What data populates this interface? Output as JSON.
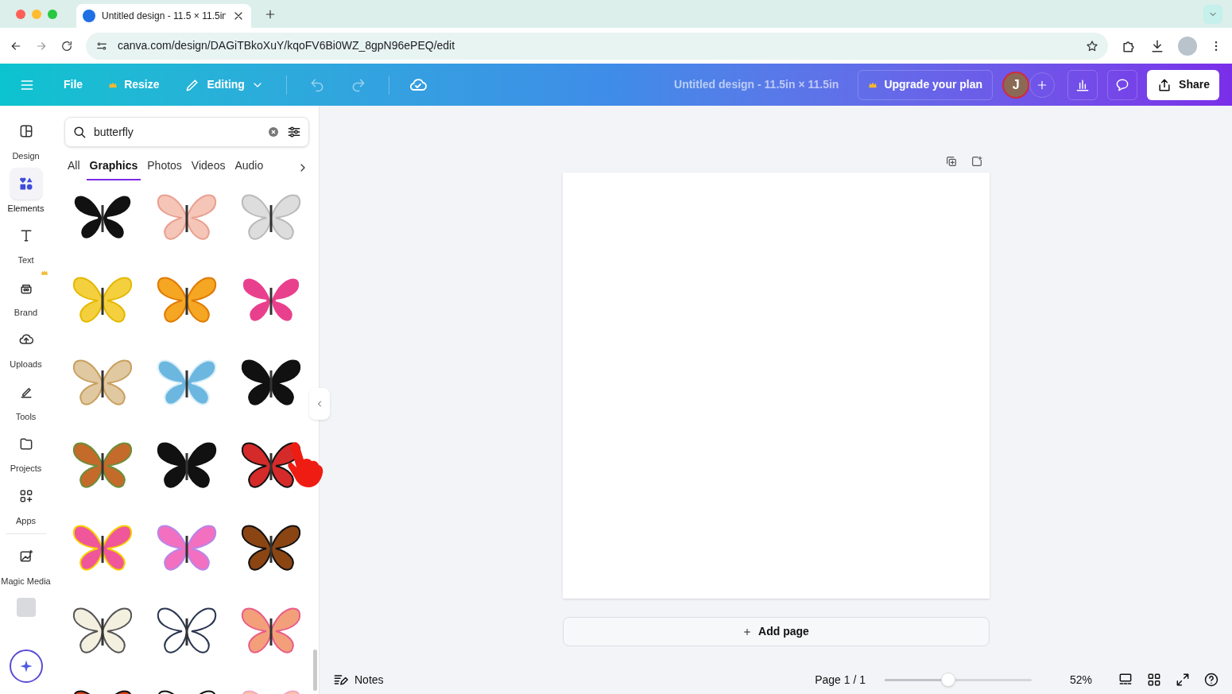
{
  "browser": {
    "tab": {
      "title": "Untitled design - 11.5 × 11.5in"
    },
    "url": "canva.com/design/DAGiTBkoXuY/kqoFV6Bi0WZ_8gpN96ePEQ/edit"
  },
  "toolbar": {
    "menu": [
      "File",
      "Resize",
      "Editing"
    ],
    "title": "Untitled design - 11.5in × 11.5in",
    "upgrade": "Upgrade your plan",
    "avatar": "J",
    "share": "Share"
  },
  "sidebar": {
    "items": [
      {
        "label": "Design",
        "selected": false
      },
      {
        "label": "Elements",
        "selected": true
      },
      {
        "label": "Text",
        "selected": false
      },
      {
        "label": "Brand",
        "selected": false
      },
      {
        "label": "Uploads",
        "selected": false
      },
      {
        "label": "Tools",
        "selected": false
      },
      {
        "label": "Projects",
        "selected": false
      },
      {
        "label": "Apps",
        "selected": false
      },
      {
        "label": "Magic Media",
        "selected": false
      }
    ]
  },
  "panel": {
    "search": {
      "value": "butterfly"
    },
    "tabs": [
      {
        "label": "All",
        "selected": false
      },
      {
        "label": "Graphics",
        "selected": true
      },
      {
        "label": "Photos",
        "selected": false
      },
      {
        "label": "Videos",
        "selected": false
      },
      {
        "label": "Audio",
        "selected": false
      }
    ]
  },
  "canvas": {
    "add_page": "Add page"
  },
  "footer": {
    "notes": "Notes",
    "page": "Page 1 / 1",
    "zoom": {
      "level": 0.43
    },
    "zoom_reading": "52%"
  }
}
